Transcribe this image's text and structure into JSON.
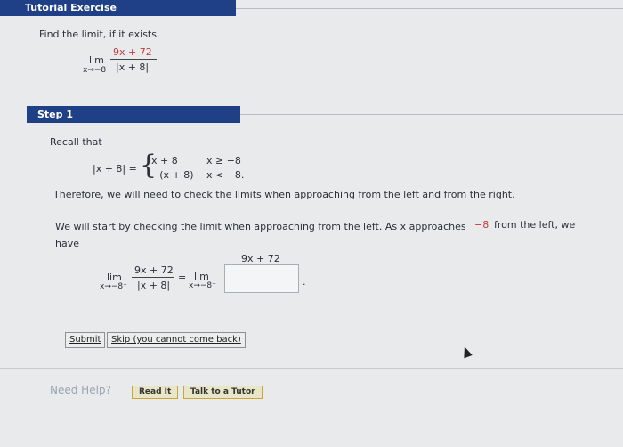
{
  "header": {
    "title": "Tutorial Exercise"
  },
  "problem": {
    "prompt": "Find the limit, if it exists.",
    "lim": "lim",
    "sub": "x→−8",
    "numerator": "9x + 72",
    "denominator": "|x + 8|"
  },
  "step": {
    "title": "Step 1",
    "recall": "Recall that",
    "abs_lhs": "|x + 8| =",
    "case1_expr": "x + 8",
    "case1_cond": "x ≥ −8",
    "case2_expr": "−(x + 8)",
    "case2_cond": "x < −8.",
    "therefore": "Therefore, we will need to check the limits when approaching from the left and from the right.",
    "start_line1_a": "We will start by checking the limit when approaching from the left. As x approaches",
    "start_line1_value": "−8",
    "start_line1_b": "from the left, we",
    "start_line2": "have",
    "left_lim": "lim",
    "left_sub": "x→−8⁻",
    "left_num": "9x + 72",
    "left_den": "|x + 8|",
    "equals": "=",
    "right_lim": "lim",
    "right_sub": "x→−8⁻",
    "right_num": "9x + 72",
    "answer_value": "",
    "period": "."
  },
  "buttons": {
    "submit": "Submit",
    "skip": "Skip (you cannot come back)"
  },
  "help": {
    "label": "Need Help?",
    "read_it": "Read It",
    "talk": "Talk to a Tutor"
  }
}
